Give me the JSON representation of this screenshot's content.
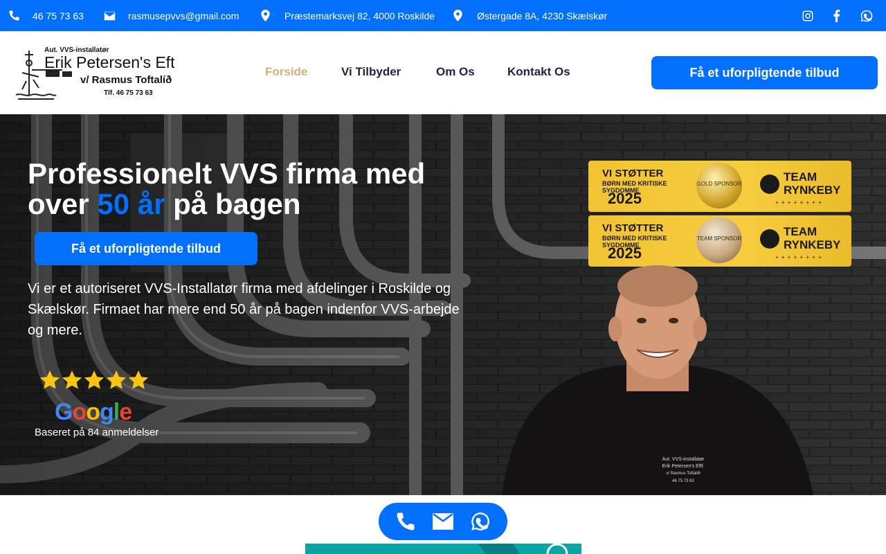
{
  "topbar": {
    "phone": "46 75 73 63",
    "email": "rasmusepvvs@gmail.com",
    "address1": "Præstemarksvej 82, 4000 Roskilde",
    "address2": "Østergade 8A, 4230 Skælskør"
  },
  "logo": {
    "line1": "Aut. VVS-installatør",
    "line2": "Erik Petersen's Eftf.",
    "line3": "v/ Rasmus Toftalíð",
    "line4": "Tlf. 46 75 73 63"
  },
  "nav": {
    "items": [
      {
        "label": "Forside",
        "active": true
      },
      {
        "label": "Vi Tilbyder",
        "active": false
      },
      {
        "label": "Om Os",
        "active": false
      },
      {
        "label": "Kontakt Os",
        "active": false
      }
    ]
  },
  "header_cta": "Få et uforpligtende tilbud",
  "hero": {
    "title_part1": "Professionelt VVS firma med over ",
    "title_accent": "50 år",
    "title_part2": " på bagen",
    "cta": "Få et uforpligtende tilbud",
    "description": "Vi er et autoriseret VVS-Installatør firma med afdelinger i Roskilde og Skælskør. Firmaet har mere end 50 år på bagen indenfor VVS-arbejde og mere.",
    "rating_stars": 5,
    "google_logo": "Google",
    "reviews": "Baseret på 84 anmeldelser"
  },
  "badges": [
    {
      "line1": "VI STØTTER",
      "line2": "BØRN MED KRITISKE SYGDOMME",
      "year": "2025",
      "medal": "GOLD SPONSOR",
      "team": "TEAM RYNKEBY"
    },
    {
      "line1": "VI STØTTER",
      "line2": "BØRN MED KRITISKE SYGDOMME",
      "year": "2025",
      "medal": "TEAM SPONSOR",
      "team": "TEAM RYNKEBY"
    }
  ],
  "shirt_text": "Aut. VVS-installatør Erik Petersen's Eftf. v/ Rasmus Toftalíð 46 75 73 63",
  "colors": {
    "brand_blue": "#0170fe",
    "nav_dark": "#1d2344",
    "nav_active": "#d1b27a",
    "star": "#f9c413"
  },
  "icons": [
    "phone-icon",
    "envelope-icon",
    "map-marker-icon",
    "instagram-icon",
    "facebook-icon",
    "whatsapp-icon",
    "star-icon"
  ]
}
